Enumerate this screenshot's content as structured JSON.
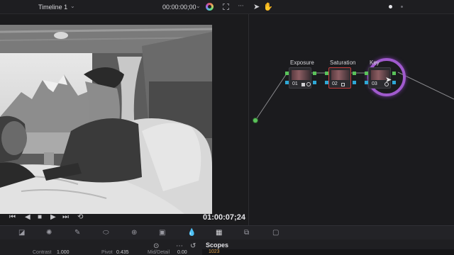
{
  "topbar": {
    "timeline_name": "Timeline 1",
    "timecode": "00:00:00;00"
  },
  "viewer": {
    "timecode": "01:00:07;24"
  },
  "nodes": [
    {
      "label": "Exposure",
      "number": "01"
    },
    {
      "label": "Saturation",
      "number": "02"
    },
    {
      "label": "Key",
      "number": "03"
    }
  ],
  "panel": {
    "scopes_label": "Scopes",
    "scope_value": "1023",
    "params": [
      "Contrast",
      "1.000",
      "Pivot",
      "0.435",
      "Mid/Detail",
      "0.00"
    ]
  },
  "colors": {
    "selection_ring": "#a05acd",
    "node_selected_border": "#c23b3b",
    "port_input": "#5ac35a",
    "port_key": "#2ea8d6"
  }
}
